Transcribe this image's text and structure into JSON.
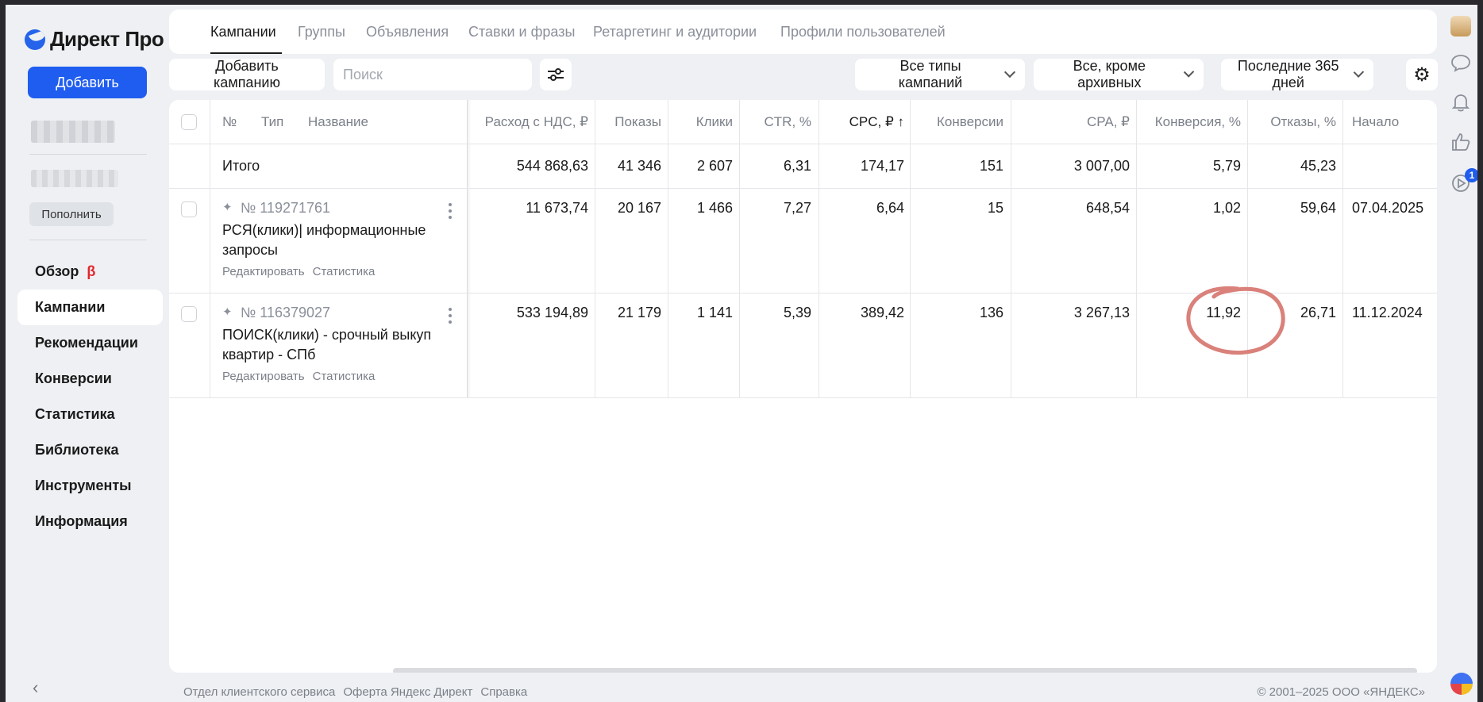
{
  "sidebar": {
    "logo": "Директ Про",
    "add_button": "Добавить",
    "topup_button": "Пополнить",
    "nav": [
      {
        "label": "Обзор",
        "badge": "β"
      },
      {
        "label": "Кампании",
        "active": true
      },
      {
        "label": "Рекомендации"
      },
      {
        "label": "Конверсии"
      },
      {
        "label": "Статистика"
      },
      {
        "label": "Библиотека"
      },
      {
        "label": "Инструменты"
      },
      {
        "label": "Информация"
      }
    ]
  },
  "tabs": [
    "Кампании",
    "Группы",
    "Объявления",
    "Ставки и фразы",
    "Ретаргетинг и аудитории",
    "Профили пользователей"
  ],
  "toolbar": {
    "add_campaign": "Добавить кампанию",
    "search_placeholder": "Поиск",
    "filter_types": "Все типы кампаний",
    "filter_status": "Все, кроме архивных",
    "filter_period": "Последние 365 дней"
  },
  "table": {
    "headers": {
      "num": "№",
      "type": "Тип",
      "name": "Название",
      "spend": "Расход с НДС, ₽",
      "impressions": "Показы",
      "clicks": "Клики",
      "ctr": "CTR, %",
      "cpc": "CPC, ₽ ↑",
      "conversions": "Конверсии",
      "cpa": "CPA, ₽",
      "conv_rate": "Конверсия, %",
      "bounce": "Отказы, %",
      "start": "Начало"
    },
    "total": {
      "label": "Итого",
      "spend": "544 868,63",
      "impressions": "41 346",
      "clicks": "2 607",
      "ctr": "6,31",
      "cpc": "174,17",
      "conversions": "151",
      "cpa": "3 007,00",
      "conv_rate": "5,79",
      "bounce": "45,23"
    },
    "rows": [
      {
        "id": "№ 119271761",
        "name": "РСЯ(клики)| информационные запросы",
        "edit": "Редактировать",
        "stats": "Статистика",
        "spend": "11 673,74",
        "impressions": "20 167",
        "clicks": "1 466",
        "ctr": "7,27",
        "cpc": "6,64",
        "conversions": "15",
        "cpa": "648,54",
        "conv_rate": "1,02",
        "bounce": "59,64",
        "start": "07.04.2025"
      },
      {
        "id": "№ 116379027",
        "name": "ПОИСК(клики) - срочный выкуп квартир - СПб",
        "edit": "Редактировать",
        "stats": "Статистика",
        "spend": "533 194,89",
        "impressions": "21 179",
        "clicks": "1 141",
        "ctr": "5,39",
        "cpc": "389,42",
        "conversions": "136",
        "cpa": "3 267,13",
        "conv_rate": "11,92",
        "bounce": "26,71",
        "start": "11.12.2024"
      }
    ]
  },
  "footer": {
    "links": [
      "Отдел клиентского сервиса",
      "Оферта Яндекс Директ",
      "Справка"
    ],
    "copyright": "© 2001–2025 ООО «ЯНДЕКС»"
  },
  "rail": {
    "notification_count": "1"
  },
  "colors": {
    "accent": "#1f5cf0",
    "beta": "#e0262b",
    "annotation": "#d9817a"
  }
}
